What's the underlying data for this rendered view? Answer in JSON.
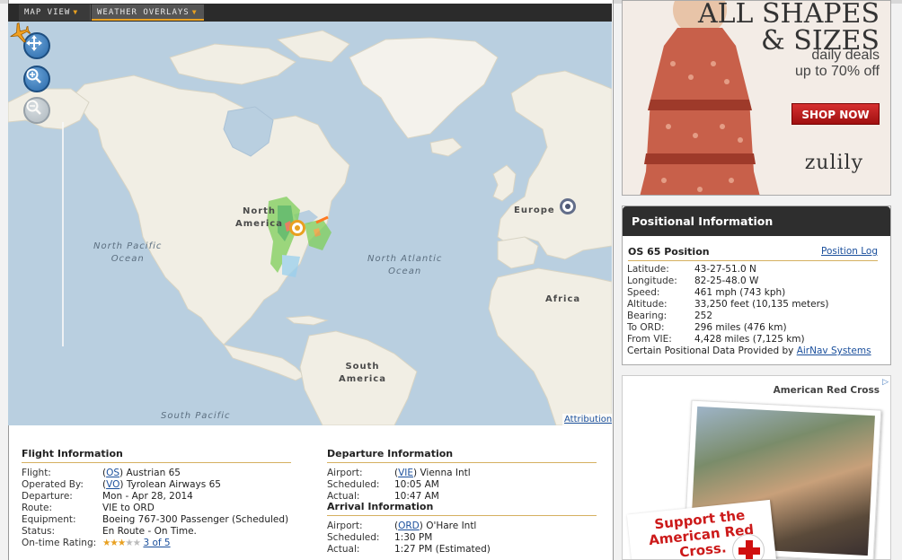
{
  "toolbar": {
    "map_view": "Map View",
    "weather_overlays": "Weather Overlays"
  },
  "map": {
    "labels": {
      "north_pacific": "North Pacific\nOcean",
      "north_atlantic": "North Atlantic\nOcean",
      "south_pacific": "South Pacific",
      "north_america": "North\nAmerica",
      "south_america": "South\nAmerica",
      "europe": "Europe",
      "africa": "Africa"
    },
    "attribution": "Attribution",
    "icons": {
      "pan": "pan-icon",
      "zoom_in": "zoom-in-icon",
      "zoom_out": "zoom-out-icon",
      "plane": "airplane-icon",
      "origin": "origin-marker-icon",
      "destination": "destination-marker-icon"
    }
  },
  "flight_info": {
    "title": "Flight Information",
    "flight_label": "Flight:",
    "flight_code": "OS",
    "flight_name": "Austrian 65",
    "operated_label": "Operated By:",
    "operated_code": "VO",
    "operated_name": "Tyrolean Airways 65",
    "departure_label": "Departure:",
    "departure_value": "Mon - Apr 28, 2014",
    "route_label": "Route:",
    "route_value": "VIE to ORD",
    "equipment_label": "Equipment:",
    "equipment_value": "Boeing 767-300 Passenger (Scheduled)",
    "status_label": "Status:",
    "status_value": "En Route - On Time.",
    "ontime_label": "On-time Rating:",
    "ontime_stars": 3,
    "ontime_link": "3 of 5"
  },
  "departure_info": {
    "title": "Departure Information",
    "airport_label": "Airport:",
    "airport_code": "VIE",
    "airport_name": "Vienna Intl",
    "scheduled_label": "Scheduled:",
    "scheduled_value": "10:05 AM",
    "actual_label": "Actual:",
    "actual_value": "10:47 AM"
  },
  "arrival_info": {
    "title": "Arrival Information",
    "airport_label": "Airport:",
    "airport_code": "ORD",
    "airport_name": "O'Hare Intl",
    "scheduled_label": "Scheduled:",
    "scheduled_value": "1:30 PM",
    "actual_label": "Actual:",
    "actual_value": "1:27 PM (Estimated)"
  },
  "ad_top": {
    "headline": "ALL SHAPES\n& SIZES",
    "deals": "daily deals\nup to 70% off",
    "button": "SHOP NOW",
    "brand": "zulily"
  },
  "positional": {
    "header": "Positional Information",
    "subtitle": "OS 65 Position",
    "log_link": "Position Log",
    "rows": [
      {
        "k": "Latitude:",
        "v": "43-27-51.0 N"
      },
      {
        "k": "Longitude:",
        "v": "82-25-48.0 W"
      },
      {
        "k": "Speed:",
        "v": "461 mph (743 kph)"
      },
      {
        "k": "Altitude:",
        "v": "33,250 feet (10,135 meters)"
      },
      {
        "k": "Bearing:",
        "v": "252"
      },
      {
        "k": "To ORD:",
        "v": "296 miles (476 km)"
      },
      {
        "k": "From VIE:",
        "v": "4,428 miles (7,125 km)"
      }
    ],
    "provided_text": "Certain Positional Data Provided by",
    "provided_link": "AirNav Systems"
  },
  "ad_bottom": {
    "org": "American Red Cross",
    "tagline": "Support the American Red Cross."
  },
  "colors": {
    "accent": "#e8a020",
    "link": "#1a4f9c",
    "header_dark": "#2e2e2e",
    "ocean": "#b9cfe0",
    "land": "#f1eee4"
  }
}
